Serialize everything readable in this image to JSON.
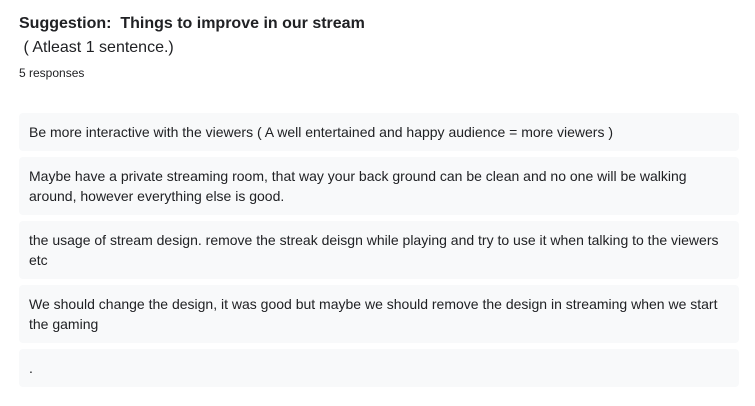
{
  "question": {
    "title": "Suggestion:  Things to improve in our stream",
    "subtitle": " ( Atleast 1 sentence.)",
    "response_count": "5 responses"
  },
  "responses": [
    "Be more interactive with the viewers ( A well entertained and happy audience = more viewers )",
    "Maybe have a private streaming room, that way your back ground can be clean and no one will be walking around, however everything else is good.",
    "the usage of stream design. remove the streak deisgn while playing and try to use it when talking to the viewers etc",
    "We should change the design, it was good but maybe we should remove the design in streaming when we start the gaming",
    "."
  ]
}
